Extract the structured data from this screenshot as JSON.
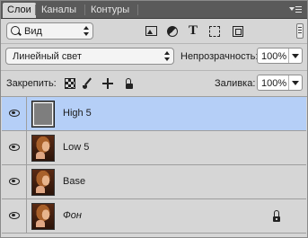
{
  "tabs": [
    {
      "label": "Слои",
      "active": true
    },
    {
      "label": "Каналы",
      "active": false
    },
    {
      "label": "Контуры",
      "active": false
    }
  ],
  "filter": {
    "kind_label": "Вид",
    "icons": [
      "image-filter-icon",
      "adjustment-filter-icon",
      "type-filter-icon",
      "shape-filter-icon",
      "smart-object-filter-icon"
    ]
  },
  "blend": {
    "mode": "Линейный свет",
    "opacity_label": "Непрозрачность:",
    "opacity_value": "100%"
  },
  "lock": {
    "label": "Закрепить:",
    "fill_label": "Заливка:",
    "fill_value": "100%"
  },
  "layers": [
    {
      "name": "High 5",
      "thumbnail": "gray",
      "visible": true,
      "selected": true,
      "locked": false
    },
    {
      "name": "Low 5",
      "thumbnail": "photo",
      "visible": true,
      "selected": false,
      "locked": false
    },
    {
      "name": "Base",
      "thumbnail": "photo",
      "visible": true,
      "selected": false,
      "locked": false
    },
    {
      "name": "Фон",
      "thumbnail": "photo",
      "visible": true,
      "selected": false,
      "locked": true
    }
  ],
  "colors": {
    "selection": "#b5cff7",
    "panel_bg": "#d6d6d6",
    "tabbar_bg": "#5a5a5a"
  }
}
